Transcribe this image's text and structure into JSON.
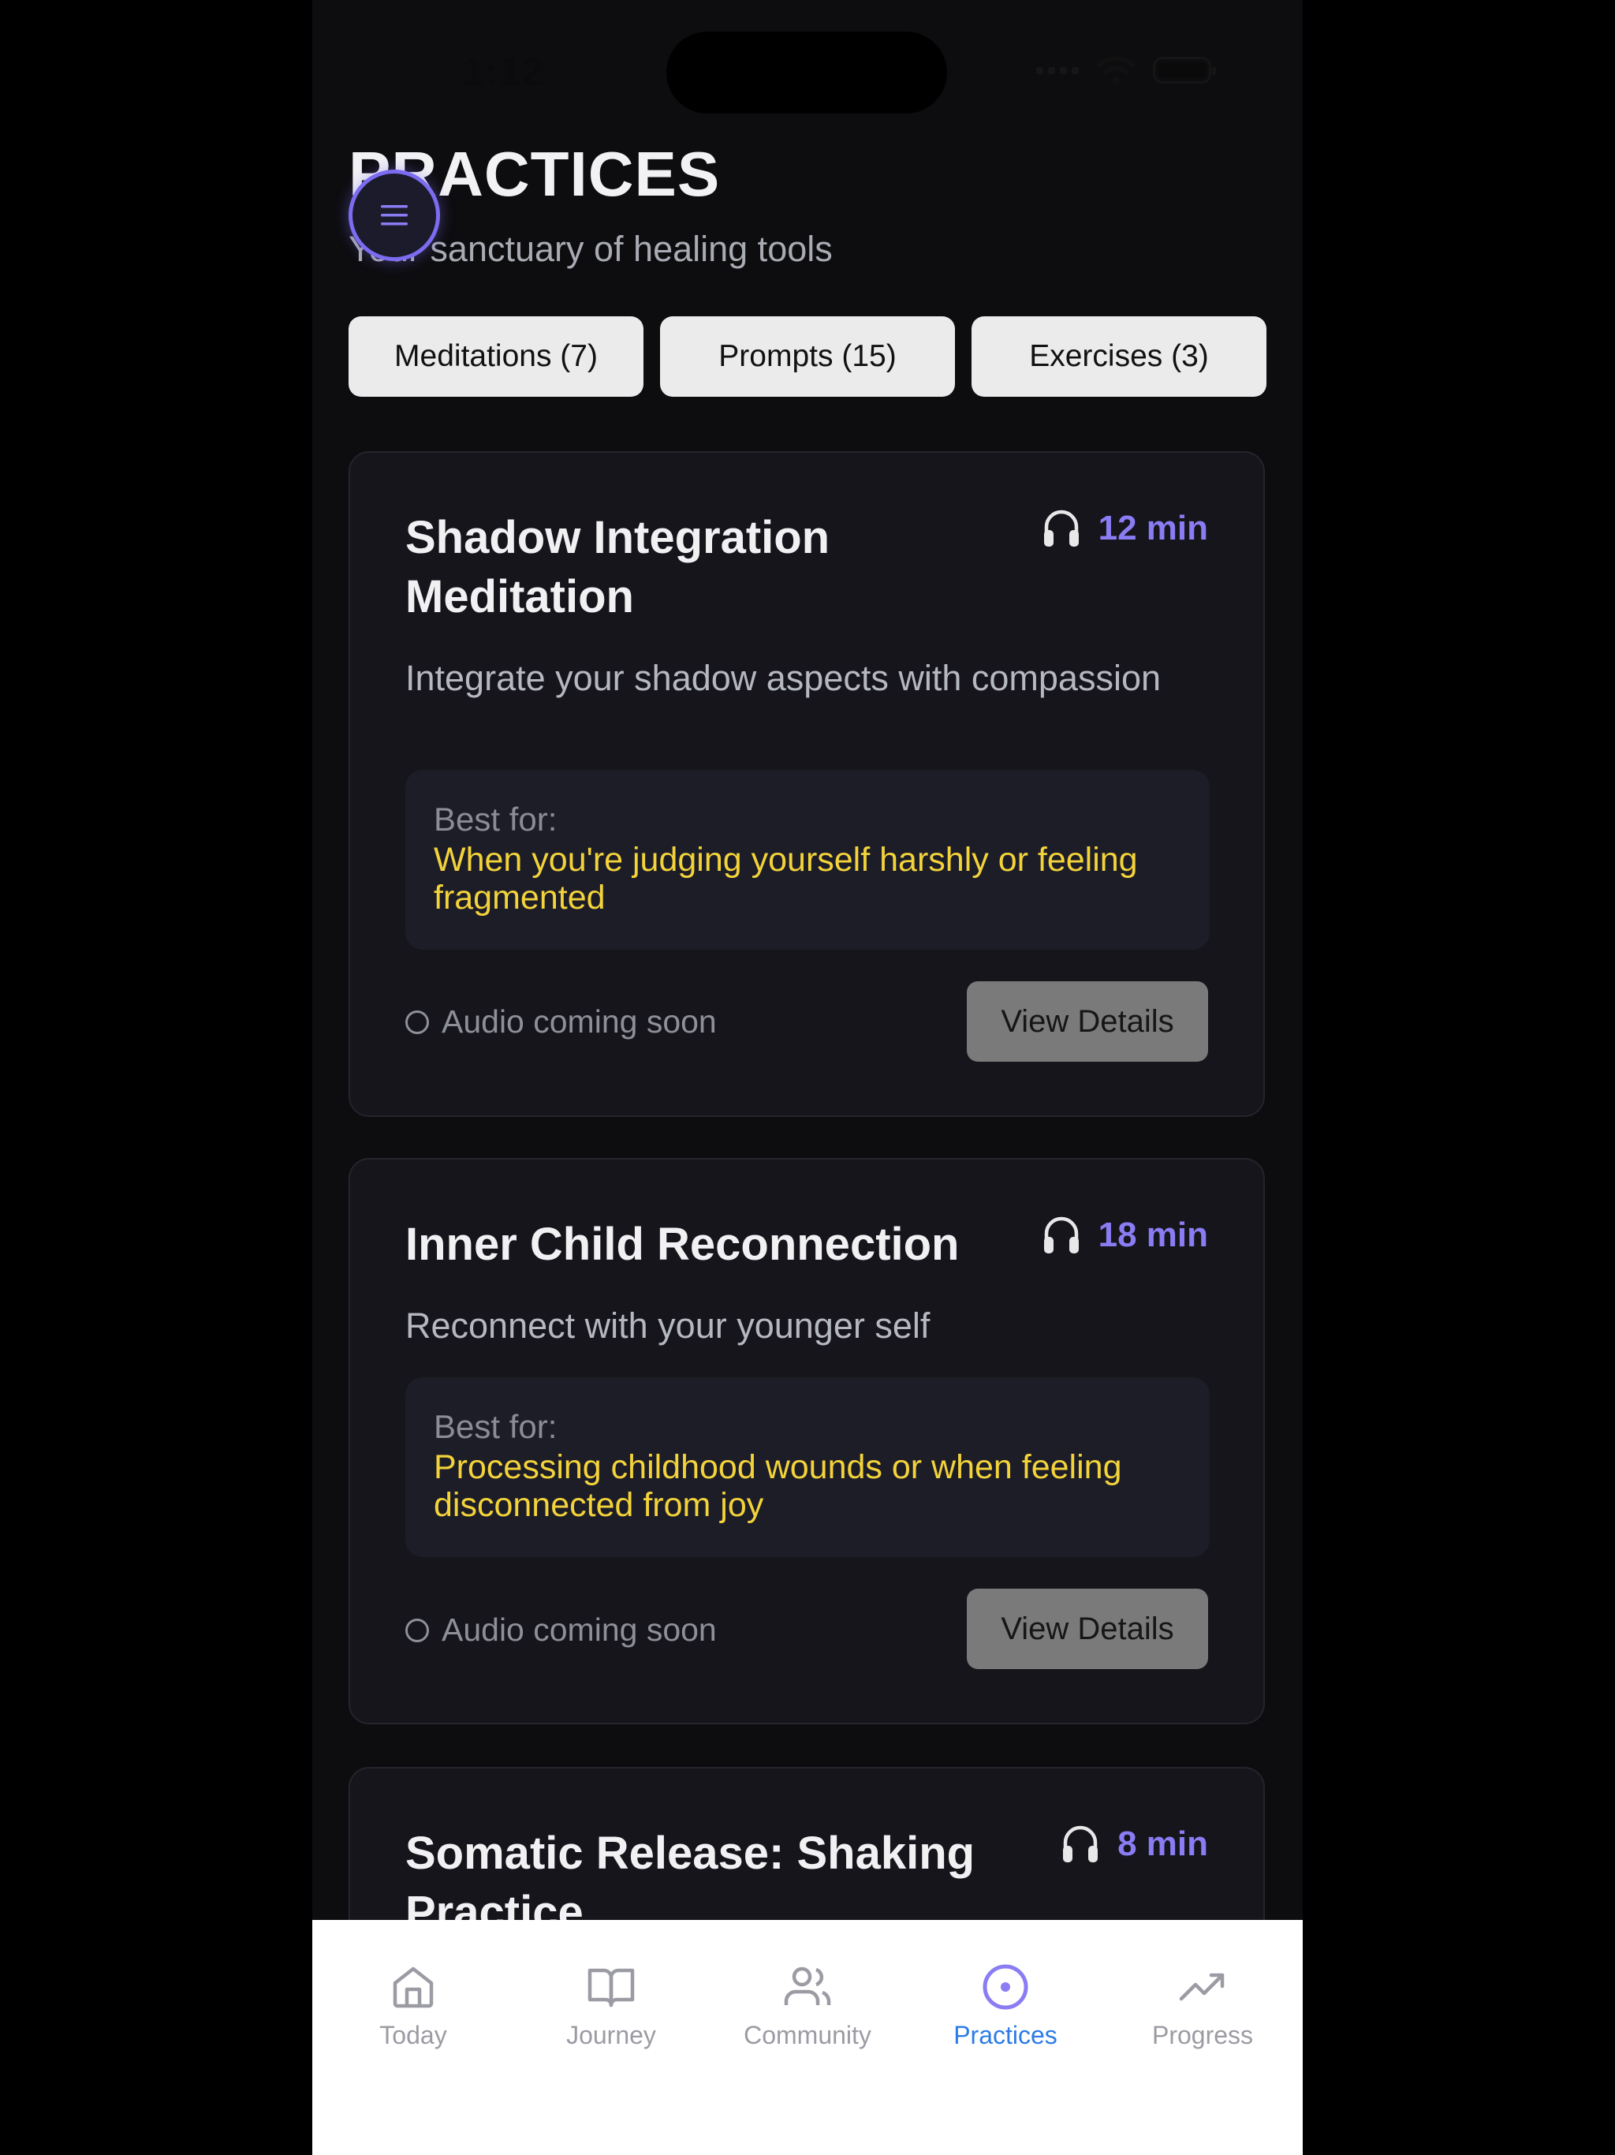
{
  "status_bar": {
    "time": "1:12"
  },
  "header": {
    "title": "PRACTICES",
    "subtitle": "Your sanctuary of healing tools"
  },
  "tabs": [
    {
      "label": "Meditations (7)"
    },
    {
      "label": "Prompts (15)"
    },
    {
      "label": "Exercises (3)"
    }
  ],
  "cards": [
    {
      "title": "Shadow Integration Meditation",
      "duration": "12 min",
      "description": "Integrate your shadow aspects with compassion",
      "best_for_label": "Best for:",
      "best_for": "When you're judging yourself harshly or feeling fragmented",
      "audio_status": "Audio coming soon",
      "button": "View Details"
    },
    {
      "title": "Inner Child Reconnection",
      "duration": "18 min",
      "description": "Reconnect with your younger self",
      "best_for_label": "Best for:",
      "best_for": "Processing childhood wounds or when feeling disconnected from joy",
      "audio_status": "Audio coming soon",
      "button": "View Details"
    },
    {
      "title": "Somatic Release: Shaking Practice",
      "duration": "8 min"
    }
  ],
  "bottom_nav": [
    {
      "label": "Today",
      "icon": "home-icon"
    },
    {
      "label": "Journey",
      "icon": "book-icon"
    },
    {
      "label": "Community",
      "icon": "users-icon"
    },
    {
      "label": "Practices",
      "icon": "target-icon",
      "active": true
    },
    {
      "label": "Progress",
      "icon": "trending-up-icon"
    }
  ],
  "colors": {
    "accent": "#8a7cf3",
    "highlight": "#f3d33a",
    "active_nav": "#2d7be6"
  }
}
